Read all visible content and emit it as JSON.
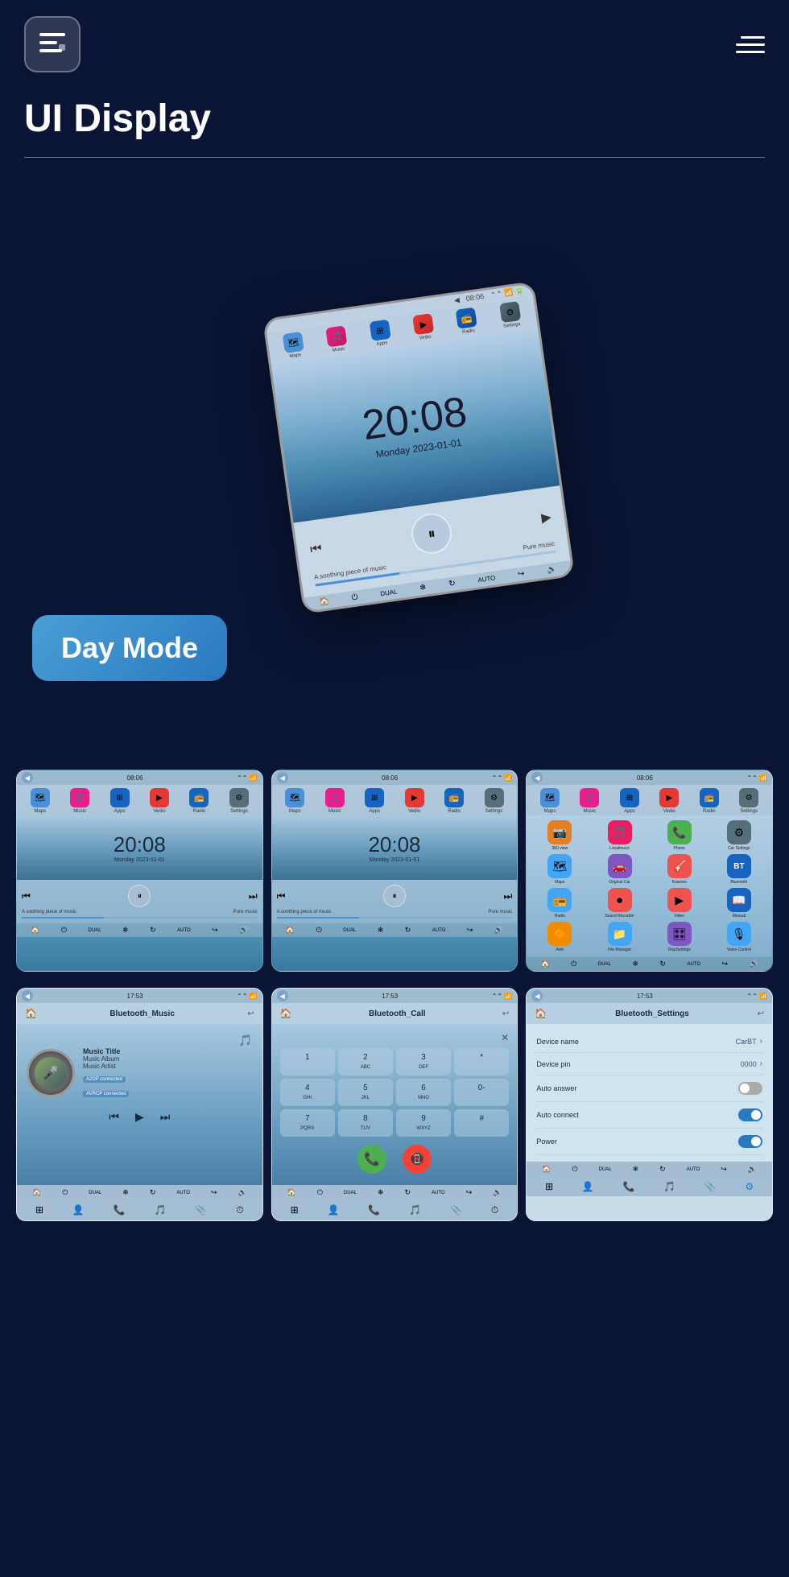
{
  "header": {
    "logo_label": "Menu",
    "title": "UI Display",
    "hamburger_label": "Menu toggle"
  },
  "colors": {
    "background": "#0a1535",
    "accent_blue": "#2979c0",
    "panel_bg": "#b8cfe0"
  },
  "day_mode": {
    "label": "Day Mode"
  },
  "tablet": {
    "status_time": "08:06",
    "clock": "20:08",
    "date": "Monday  2023-01-01",
    "music_label": "A soothing piece of music",
    "music_right": "Pure music",
    "apps": [
      {
        "label": "Maps",
        "icon": "🗺"
      },
      {
        "label": "Music",
        "icon": "🎵"
      },
      {
        "label": "Apps",
        "icon": "📱"
      },
      {
        "label": "Vedio",
        "icon": "▶"
      },
      {
        "label": "Radio",
        "icon": "📻"
      },
      {
        "label": "Settings",
        "icon": "⚙"
      }
    ]
  },
  "panels": [
    {
      "id": "panel1",
      "status_time": "08:06",
      "clock": "20:08",
      "date": "Monday  2023-01-01",
      "music_label": "A soothing piece of music",
      "music_right": "Pure music"
    },
    {
      "id": "panel2",
      "status_time": "08:06",
      "clock": "20:08",
      "date": "Monday  2023-01-01",
      "music_label": "A soothing piece of music",
      "music_right": "Pure music"
    },
    {
      "id": "panel3-appgrid",
      "status_time": "08:06",
      "apps_grid": [
        {
          "label": "360 view",
          "icon": "🔵",
          "color": "#e67e22"
        },
        {
          "label": "Localmusic",
          "icon": "🎵",
          "color": "#e91e63"
        },
        {
          "label": "Phone",
          "icon": "📞",
          "color": "#4caf50"
        },
        {
          "label": "Car Settings",
          "icon": "⚙",
          "color": "#546e7a"
        },
        {
          "label": "Maps",
          "icon": "🗺",
          "color": "#42a5f5"
        },
        {
          "label": "Original Car",
          "icon": "👾",
          "color": "#7e57c2"
        },
        {
          "label": "Kuwooo",
          "icon": "🎸",
          "color": "#ef5350"
        },
        {
          "label": "Bluetooth",
          "icon": "BT",
          "color": "#1565c0"
        },
        {
          "label": "Radio",
          "icon": "📻",
          "color": "#42a5f5"
        },
        {
          "label": "Sound Recorder",
          "icon": "⏺",
          "color": "#ef5350"
        },
        {
          "label": "Video",
          "icon": "▶",
          "color": "#ef5350"
        },
        {
          "label": "Manual",
          "icon": "📖",
          "color": "#1565c0"
        },
        {
          "label": "Avin",
          "icon": "🔶",
          "color": "#ef8c00"
        },
        {
          "label": "File Manager",
          "icon": "📁",
          "color": "#42a5f5"
        },
        {
          "label": "DispSettings",
          "icon": "🎛",
          "color": "#7e57c2"
        },
        {
          "label": "Voice Control",
          "icon": "🎙",
          "color": "#42a5f5"
        }
      ]
    }
  ],
  "bluetooth_panels": [
    {
      "id": "bt-music",
      "status_time": "17:53",
      "title": "Bluetooth_Music",
      "track_title": "Music Title",
      "track_album": "Music Album",
      "track_artist": "Music Artist",
      "badge1": "A2DP connected",
      "badge2": "AVRCP connected"
    },
    {
      "id": "bt-call",
      "status_time": "17:53",
      "title": "Bluetooth_Call",
      "numpad": [
        "1",
        "2 ABC",
        "3 DEF",
        "*",
        "4 GHI",
        "5 JKL",
        "6 MNO",
        "0-",
        "7 PQRS",
        "8 TUV",
        "9 WXYZ",
        "#"
      ]
    },
    {
      "id": "bt-settings",
      "status_time": "17:53",
      "title": "Bluetooth_Settings",
      "settings": [
        {
          "label": "Device name",
          "value": "CarBT",
          "type": "arrow"
        },
        {
          "label": "Device pin",
          "value": "0000",
          "type": "arrow"
        },
        {
          "label": "Auto answer",
          "value": "",
          "type": "toggle-off"
        },
        {
          "label": "Auto connect",
          "value": "",
          "type": "toggle-on"
        },
        {
          "label": "Power",
          "value": "",
          "type": "toggle-on"
        }
      ]
    }
  ]
}
